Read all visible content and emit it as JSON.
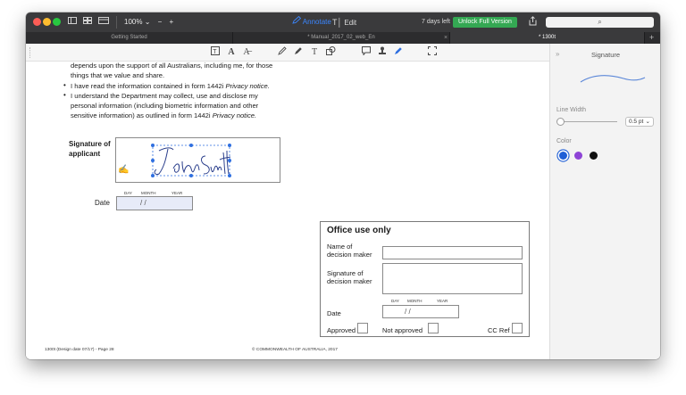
{
  "titlebar": {
    "zoom": "100%",
    "zoom_out": "−",
    "zoom_in": "+",
    "mode_annotate": "Annotate",
    "mode_edit": "Edit",
    "trial": "7 days left",
    "unlock": "Unlock Full Version",
    "search_icon": "⌕"
  },
  "tabs": [
    {
      "label": "Getting Started"
    },
    {
      "label": "* Manual_2017_02_web_En"
    },
    {
      "label": "* 1300t"
    }
  ],
  "tab_close": "×",
  "tab_add": "+",
  "toolbar": {
    "tools": [
      "text-box",
      "text",
      "text-style",
      "pencil",
      "pen",
      "type-text",
      "shape",
      "note",
      "stamp",
      "signature-pen",
      "crop"
    ]
  },
  "document": {
    "lines": [
      "depends upon the support of all Australians, including me, for those",
      "things that we value and share.",
      "I have read the information contained in form 1442i Privacy notice.",
      "I understand the Department may collect, use and disclose my",
      "personal information (including biometric information and other",
      "sensitive information) as outlined in form 1442i Privacy notice."
    ],
    "signature_label_1": "Signature of",
    "signature_label_2": "applicant",
    "date_day": "DAY",
    "date_month": "MONTH",
    "date_year": "YEAR",
    "date_label": "Date",
    "date_sep": "/          /",
    "office": {
      "title": "Office use only",
      "name_1": "Name of",
      "name_2": "decision maker",
      "sig_1": "Signature of",
      "sig_2": "decision maker",
      "date_label": "Date",
      "approved": "Approved",
      "not_approved": "Not approved",
      "cc_ref": "CC Ref"
    },
    "footer_left": "1300t (Design date 07/17) - Page 28",
    "footer_center": "© COMMONWEALTH OF AUSTRALIA, 2017"
  },
  "sidebar": {
    "collapse": "»",
    "title": "Signature",
    "line_width_label": "Line Width",
    "line_width_value": "0.5 pt",
    "line_width_fraction": 0.05,
    "color_label": "Color",
    "colors": [
      "#1f5fd6",
      "#8e44d6",
      "#111111"
    ],
    "selected_color": "#1f5fd6"
  }
}
